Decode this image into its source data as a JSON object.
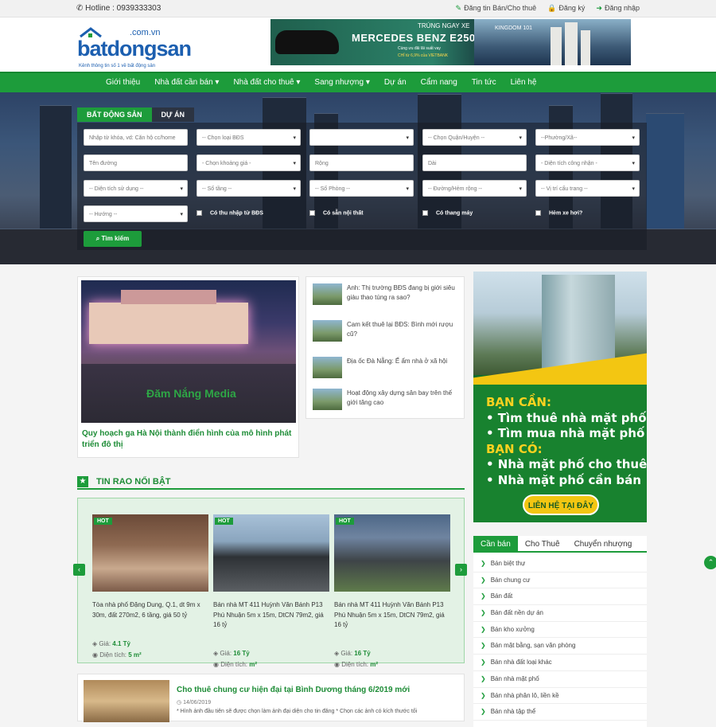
{
  "topbar": {
    "hotline": "Hotline : 0939333303",
    "links": [
      "Đăng tin Bán/Cho thuê",
      "Đăng ký",
      "Đăng nhập"
    ]
  },
  "logo": {
    "domain": ".com.vn",
    "name": "batdongsan",
    "slogan": "Kênh thông tin số 1 về bất động sản"
  },
  "banner": {
    "line1": "TRÚNG NGAY XE",
    "line2": "MERCEDES BENZ E250",
    "line3": "Cùng ưu đãi lãi suất vay",
    "line4": "CHỈ từ 6,9% của VIETBANK",
    "right_label": "KINGDOM 101"
  },
  "nav": [
    "Giới thiệu",
    "Nhà đất cần bán ▾",
    "Nhà đất cho thuê ▾",
    "Sang nhượng ▾",
    "Dự án",
    "Cẩm nang",
    "Tin tức",
    "Liên hệ"
  ],
  "hero": {
    "tabs": [
      "BẤT ĐỘNG SẢN",
      "DỰ ÁN"
    ],
    "fields": {
      "keyword": "Nhập từ khóa, vd: Căn hộ cc/home",
      "type": "-- Chọn loại BĐS",
      "blank": "",
      "district": "-- Chọn Quận/Huyện --",
      "ward": "--Phường/Xã--",
      "street": "Tên đường",
      "price": "- Chọn khoảng giá -",
      "width": "Rộng",
      "length": "Dài",
      "land_area": "- Diện tích công nhận -",
      "use_area": "-- Diện tích sử dụng --",
      "floors": "-- Số tầng --",
      "rooms": "-- Số Phòng --",
      "road": "-- Đường/Hẻm rộng --",
      "position": "-- Vị trí cấu trang --",
      "direction": "-- Hướng --"
    },
    "checks": [
      "Có thu nhập từ BĐS",
      "Có sẵn nội thất",
      "Có thang máy",
      "Hẻm xe hơi?"
    ],
    "search_button": "Tìm kiếm"
  },
  "featured": {
    "caption": "Quy hoạch ga Hà Nội thành điển hình của mô hình phát triển đô thị",
    "watermark": "Đăm Nắng Media"
  },
  "news": [
    "Anh: Thị trường BĐS đang bị giới siêu giàu thao túng ra sao?",
    "Cam kết thuê lại BĐS: Bình mới rượu cũ?",
    "Địa ốc Đà Nẵng: Ế ẩm nhà ở xã hội",
    "Hoạt động xây dựng sân bay trên thế giới tăng cao"
  ],
  "ad": {
    "line1": "BẠN CẦN:",
    "line2": "• Tìm thuê nhà mặt phố",
    "line3": "• Tìm mua nhà mặt phố",
    "line4": "BẠN CÓ:",
    "line5": "• Nhà mặt phố cho thuê",
    "line6": "• Nhà mặt phố cần bán",
    "cta": "LIÊN HỆ TẠI ĐÂY"
  },
  "section_title": "TIN RAO NỔI BẬT",
  "listings": [
    {
      "badge": "HOT",
      "title": "Tòa nhà phố Đặng Dung, Q.1, dt 9m x 30m, đất 270m2, 6 tầng, giá 50 tỷ",
      "price_label": "Giá:",
      "price": "4.1 Tỷ",
      "area_label": "Diện tích:",
      "area": "5 m²"
    },
    {
      "badge": "HOT",
      "title": "Bán nhà MT 411 Huỳnh Văn Bánh P13 Phú Nhuận 5m x 15m, DtCN 79m2, giá 16 tỷ",
      "price_label": "Giá:",
      "price": "16 Tỷ",
      "area_label": "Diện tích:",
      "area": "m²"
    },
    {
      "badge": "HOT",
      "title": "Bán nhà MT 411 Huỳnh Văn Bánh P13 Phú Nhuận 5m x 15m, DtCN 79m2, giá 16 tỷ",
      "price_label": "Giá:",
      "price": "16 Tỷ",
      "area_label": "Diện tích:",
      "area": "m²"
    }
  ],
  "post": {
    "title": "Cho thuê chung cư hiện đại tại Bình Dương tháng 6/2019 mới",
    "date": "14/06/2019",
    "excerpt": "* Hình ảnh đầu tiên sẽ được chọn làm ảnh đại diện cho tin đăng * Chọn các ảnh có kích thước tối"
  },
  "categories": {
    "tabs": [
      "Cần bán",
      "Cho Thuê",
      "Chuyển nhượng"
    ],
    "items": [
      "Bán biệt thự",
      "Bán chung cư",
      "Bán đất",
      "Bán đất nền dự án",
      "Bán kho xưởng",
      "Bán mặt bằng, sạn văn phòng",
      "Bán nhà đất loại khác",
      "Bán nhà mặt phố",
      "Bán nhà phân lô, liền kề",
      "Bán nhà tập thể"
    ]
  },
  "colors": {
    "primary": "#1d9c3b",
    "accent": "#f3c612",
    "brand": "#1c5fb0"
  }
}
